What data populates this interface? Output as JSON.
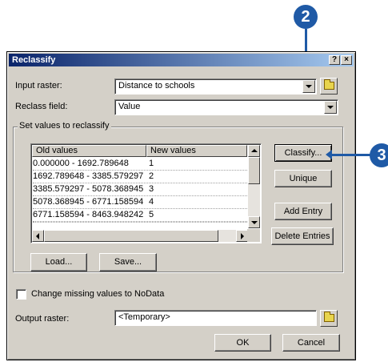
{
  "callouts": {
    "two": "2",
    "three": "3"
  },
  "dialog": {
    "title": "Reclassify",
    "help_label": "?",
    "close_label": "×",
    "input_raster": {
      "label": "Input raster:",
      "value": "Distance to schools"
    },
    "reclass_field": {
      "label": "Reclass field:",
      "value": "Value"
    },
    "group_title": "Set values to reclassify",
    "table": {
      "columns": [
        "Old values",
        "New values"
      ],
      "rows": [
        [
          "0.000000 - 1692.789648",
          "1"
        ],
        [
          "1692.789648 - 3385.579297",
          "2"
        ],
        [
          "3385.579297 - 5078.368945",
          "3"
        ],
        [
          "5078.368945 - 6771.158594",
          "4"
        ],
        [
          "6771.158594 - 8463.948242",
          "5"
        ]
      ]
    },
    "buttons": {
      "classify": "Classify...",
      "unique": "Unique",
      "add_entry": "Add Entry",
      "delete_entries": "Delete Entries",
      "load": "Load...",
      "save": "Save...",
      "ok": "OK",
      "cancel": "Cancel"
    },
    "missing_checkbox": {
      "label": "Change missing values to NoData",
      "checked": false
    },
    "output_raster": {
      "label": "Output raster:",
      "value": "<Temporary>"
    }
  },
  "colors": {
    "callout": "#1f5aa6",
    "titlebar": "#0a246a",
    "face": "#d4d0c8"
  }
}
